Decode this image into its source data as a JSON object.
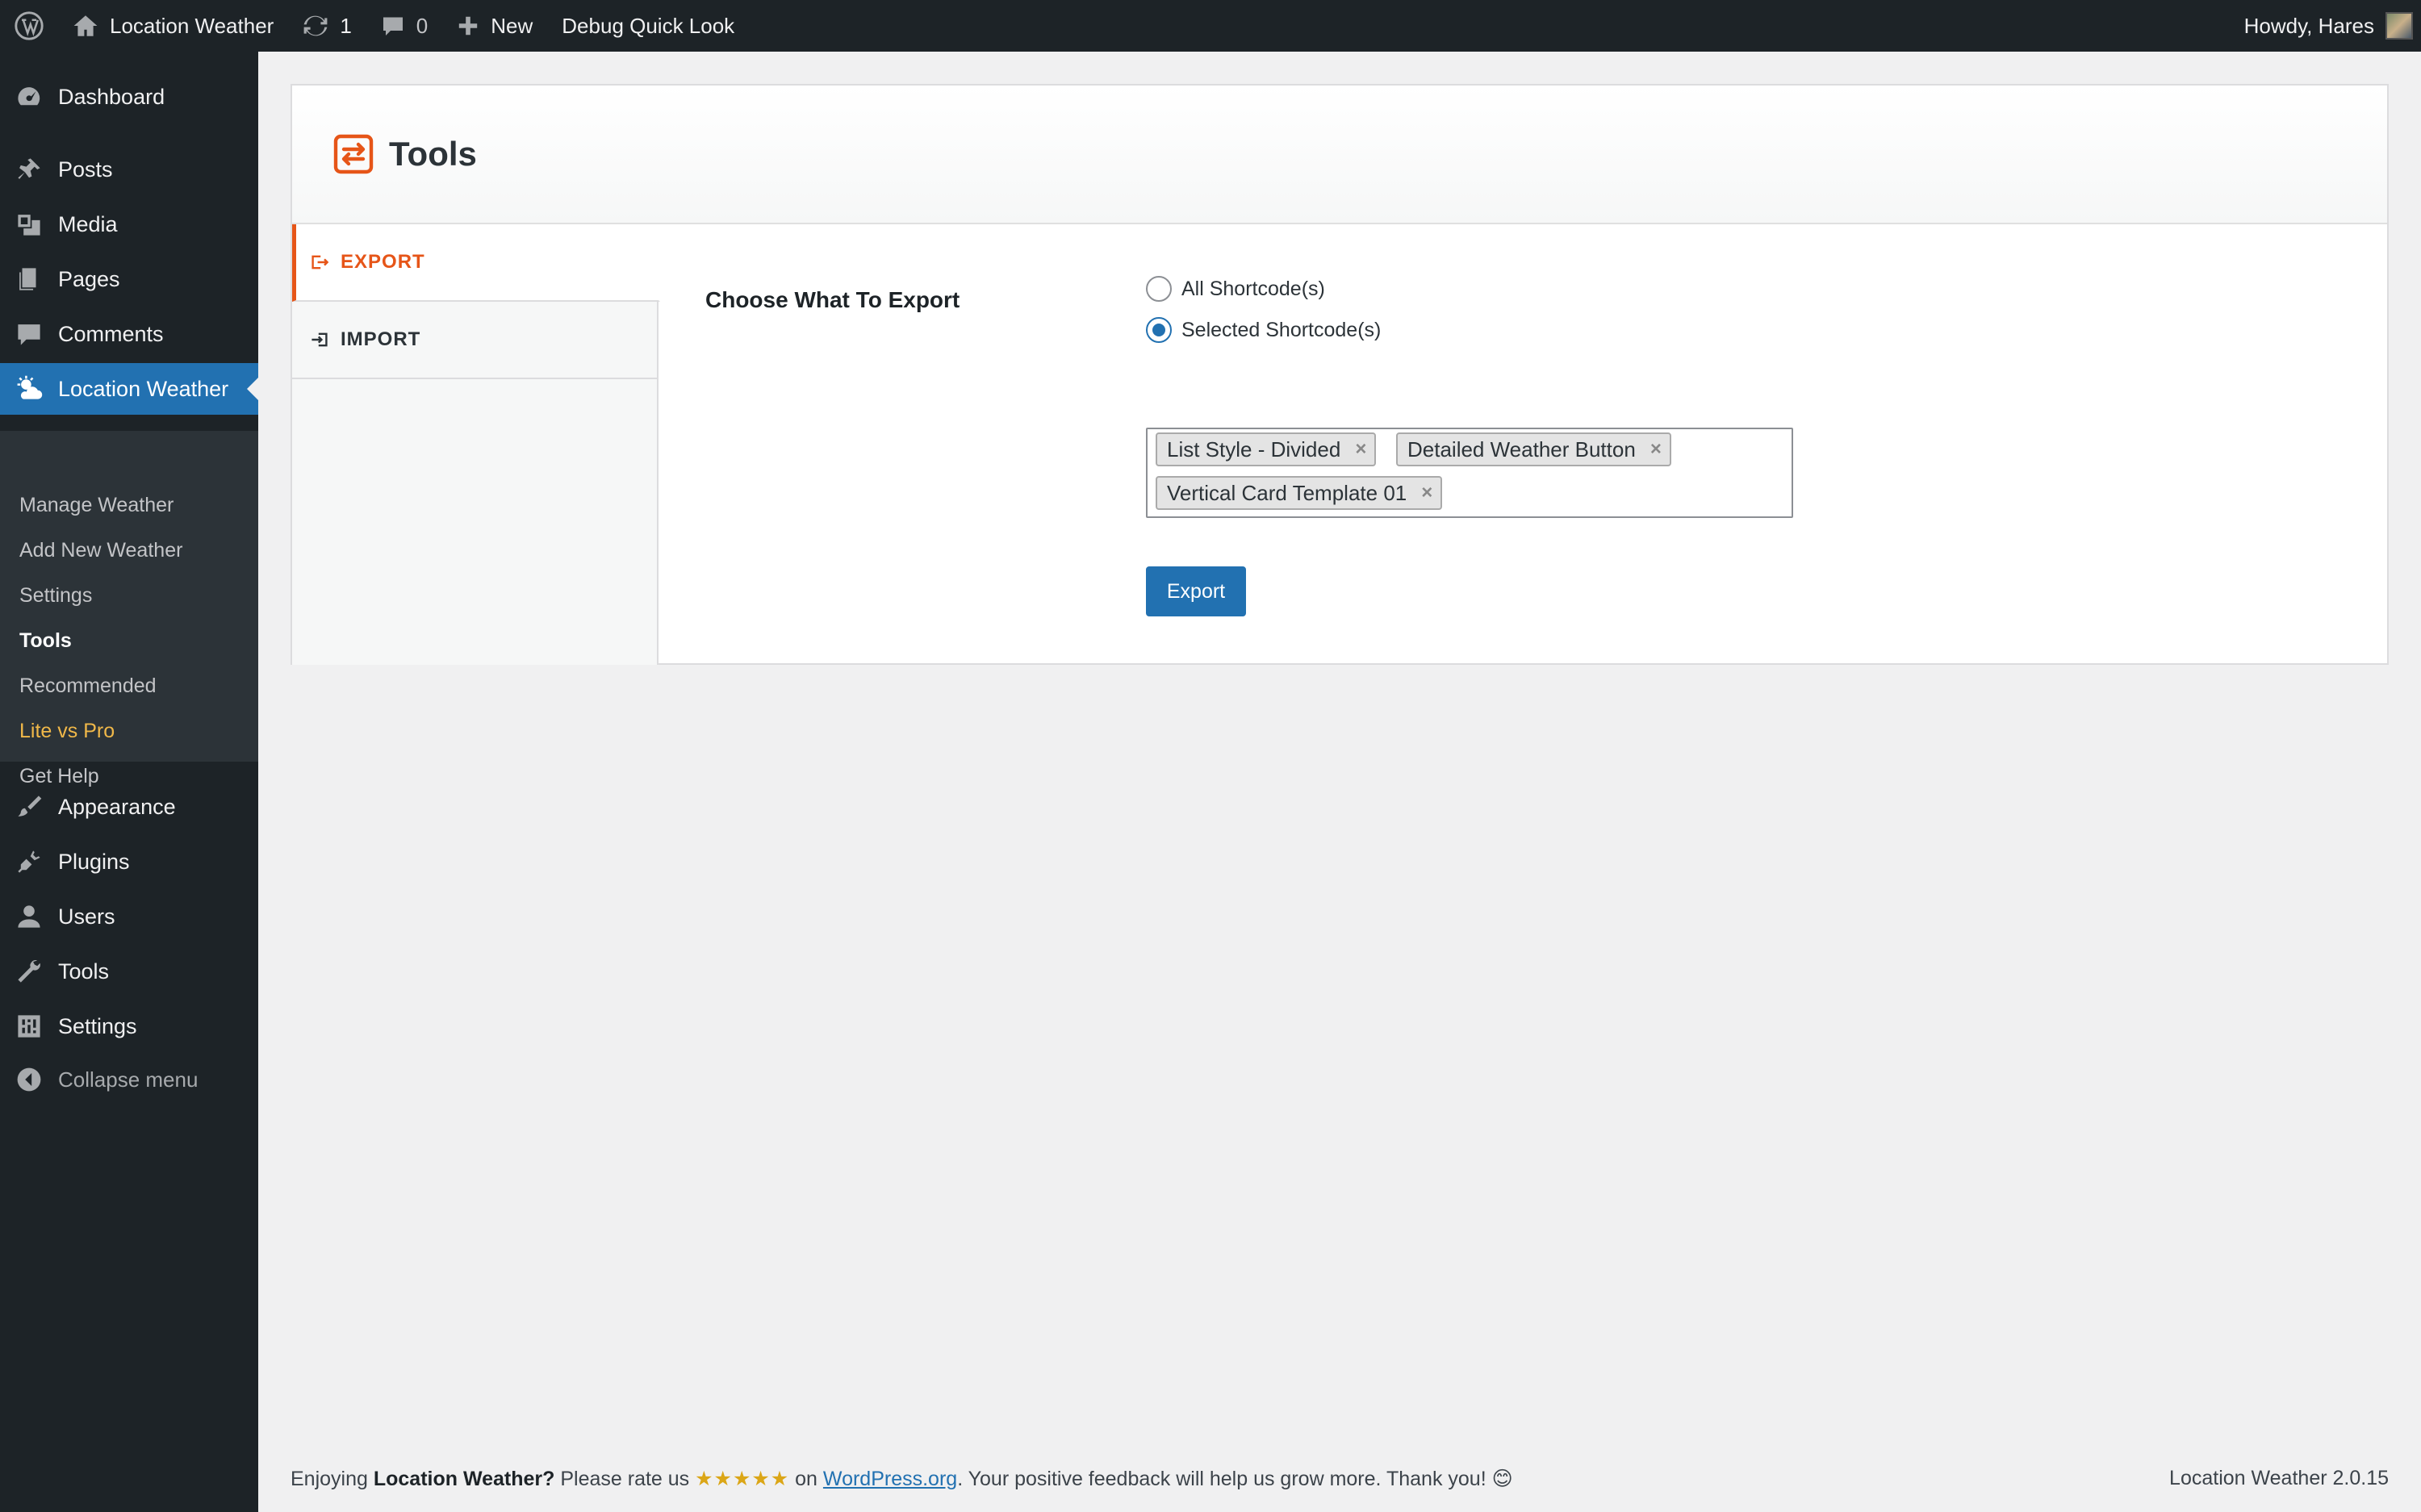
{
  "adminbar": {
    "site_name": "Location Weather",
    "updates_count": "1",
    "comments_count": "0",
    "new_label": "New",
    "debug_label": "Debug Quick Look",
    "howdy": "Howdy, Hares"
  },
  "sidebar": {
    "items": [
      {
        "label": "Dashboard",
        "icon": "dashboard-icon"
      },
      {
        "label": "Posts",
        "icon": "pin-icon"
      },
      {
        "label": "Media",
        "icon": "media-icon"
      },
      {
        "label": "Pages",
        "icon": "pages-icon"
      },
      {
        "label": "Comments",
        "icon": "comment-icon"
      },
      {
        "label": "Location Weather",
        "icon": "weather-icon"
      },
      {
        "label": "Appearance",
        "icon": "brush-icon"
      },
      {
        "label": "Plugins",
        "icon": "plugin-icon"
      },
      {
        "label": "Users",
        "icon": "user-icon"
      },
      {
        "label": "Tools",
        "icon": "wrench-icon"
      },
      {
        "label": "Settings",
        "icon": "settings-icon"
      }
    ],
    "submenu": [
      "Manage Weather",
      "Add New Weather",
      "Settings",
      "Tools",
      "Recommended",
      "Lite vs Pro",
      "Get Help"
    ],
    "collapse_label": "Collapse menu"
  },
  "page": {
    "title": "Tools",
    "tabs": [
      "EXPORT",
      "IMPORT"
    ],
    "field_label": "Choose What To Export",
    "radio_options": [
      "All Shortcode(s)",
      "Selected Shortcode(s)"
    ],
    "selected_radio": "Selected Shortcode(s)",
    "chips": [
      "List Style - Divided",
      "Detailed Weather Button",
      "Vertical Card Template 01"
    ],
    "chip_remove": "×",
    "export_button": "Export"
  },
  "footer": {
    "prefix": "Enjoying",
    "plugin": "Location Weather?",
    "rate_text": " Please rate us",
    "stars": "★★★★★",
    "on_text": " on",
    "link_text": "WordPress.org",
    "suffix": ". Your positive feedback will help us grow more. Thank you! 😊",
    "version": "Location Weather 2.0.15"
  },
  "colors": {
    "accent": "#2271b1",
    "tab_active": "#e65518",
    "admin_dark": "#1d2327",
    "pro_highlight": "#f0b849"
  }
}
